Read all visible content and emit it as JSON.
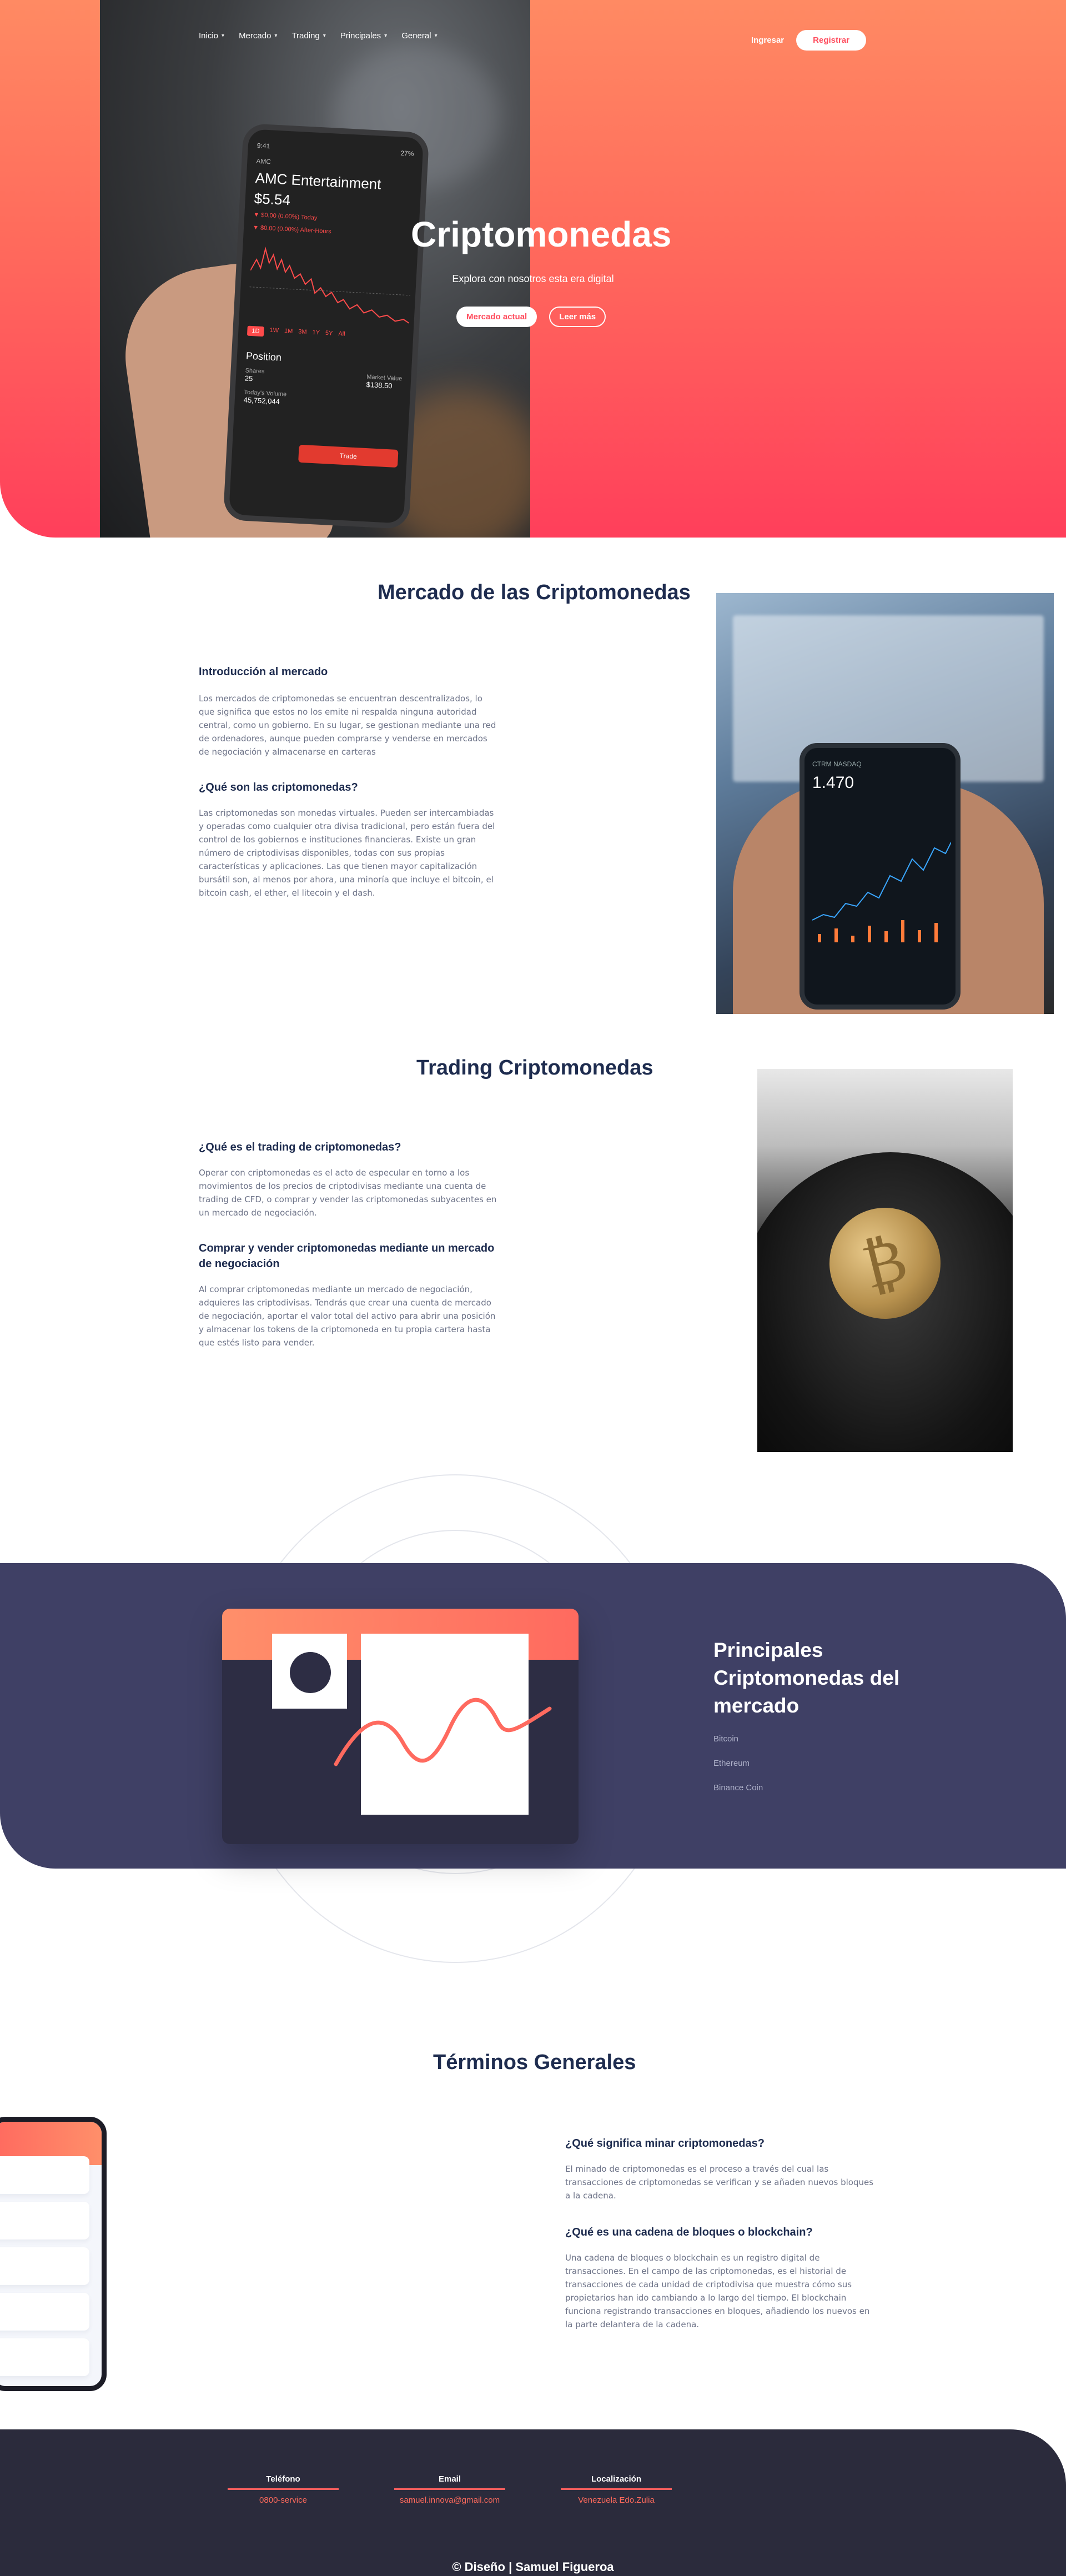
{
  "nav": {
    "items": [
      {
        "label": "Inicio"
      },
      {
        "label": "Mercado"
      },
      {
        "label": "Trading"
      },
      {
        "label": "Principales"
      },
      {
        "label": "General"
      }
    ],
    "login_label": "Ingresar",
    "register_label": "Registrar"
  },
  "hero": {
    "title": "Criptomonedas",
    "subtitle": "Explora con nosotros esta era digital",
    "primary_btn": "Mercado actual",
    "secondary_btn": "Leer más",
    "phone": {
      "status_time": "9:41",
      "status_battery": "27%",
      "ticker": "AMC",
      "name": "AMC Entertainment",
      "price": "$5.54",
      "change_today": "▼ $0.00 (0.00%) Today",
      "change_after": "▼ $0.00 (0.00%) After-Hours",
      "ranges": [
        "1D",
        "1W",
        "1M",
        "3M",
        "1Y",
        "5Y",
        "All"
      ],
      "position_label": "Position",
      "trade_label": "Trade",
      "shares_label": "Shares",
      "shares_value": "25",
      "market_value_label": "Market Value",
      "market_value": "$138.50",
      "volume_label": "Today's Volume",
      "volume_value": "45,752,044"
    }
  },
  "mercado": {
    "title": "Mercado de las Criptomonedas",
    "intro_heading": "Introducción al mercado",
    "intro_text": "Los mercados de criptomonedas se encuentran descentralizados, lo que significa que estos no los emite ni respalda ninguna autoridad central, como un gobierno. En su lugar, se gestionan mediante una red de ordenadores, aunque pueden comprarse y venderse en mercados de negociación y almacenarse en carteras",
    "que_heading": "¿Qué son las criptomonedas?",
    "que_text": "Las criptomonedas son monedas virtuales. Pueden ser intercambiadas y operadas como cualquier otra divisa tradicional, pero están fuera del control de los gobiernos e instituciones financieras. Existe un gran número de criptodivisas disponibles, todas con sus propias características y aplicaciones. Las que tienen mayor capitalización bursátil son, al menos por ahora, una minoría que incluye el bitcoin, el bitcoin cash, el ether, el litecoin y el dash.",
    "phone": {
      "ticker": "CTRM NASDAQ",
      "value": "1.470"
    }
  },
  "trading": {
    "title": "Trading Criptomonedas",
    "q1_heading": "¿Qué es el trading de criptomonedas?",
    "q1_text": "Operar con criptomonedas es el acto de especular en torno a los movimientos de los precios de criptodivisas mediante una cuenta de trading de CFD, o comprar y vender las criptomonedas subyacentes en un mercado de negociación.",
    "q2_heading": "Comprar y vender criptomonedas mediante un mercado de negociación",
    "q2_text": "Al comprar criptomonedas mediante un mercado de negociación, adquieres las criptodivisas. Tendrás que crear una cuenta de mercado de negociación, aportar el valor total del activo para abrir una posición y almacenar los tokens de la criptomoneda en tu propia cartera hasta que estés listo para vender."
  },
  "principales": {
    "title": "Principales Criptomonedas del mercado",
    "coins": [
      {
        "label": "Bitcoin"
      },
      {
        "label": "Ethereum"
      },
      {
        "label": "Binance Coin"
      }
    ]
  },
  "terminos": {
    "title": "Términos Generales",
    "q1_heading": "¿Qué significa minar criptomonedas?",
    "q1_text": "El minado de criptomonedas es el proceso a través del cual las transacciones de criptomonedas se verifican y se añaden nuevos bloques a la cadena.",
    "q2_heading": "¿Qué es una cadena de bloques o blockchain?",
    "q2_text": "Una cadena de bloques o blockchain es un registro digital de transacciones. En el campo de las criptomonedas, es el historial de transacciones de cada unidad de criptodivisa que muestra cómo sus propietarios han ido cambiando a lo largo del tiempo. El blockchain funciona registrando transacciones en bloques, añadiendo los nuevos en la parte delantera de la cadena."
  },
  "footer": {
    "phone_label": "Teléfono",
    "phone_value": "0800-service",
    "email_label": "Email",
    "email_value": "samuel.innova@gmail.com",
    "location_label": "Localización",
    "location_value": "Venezuela Edo.Zulia",
    "copyright": "© Diseño | Samuel Figueroa"
  },
  "colors": {
    "hero_gradient_top": "#ff8a63",
    "hero_gradient_bottom": "#ff3f5b",
    "navy_text": "#1e2c4f",
    "band": "#3f4065",
    "footer": "#2b2b3c",
    "accent": "#ff5e5e"
  }
}
